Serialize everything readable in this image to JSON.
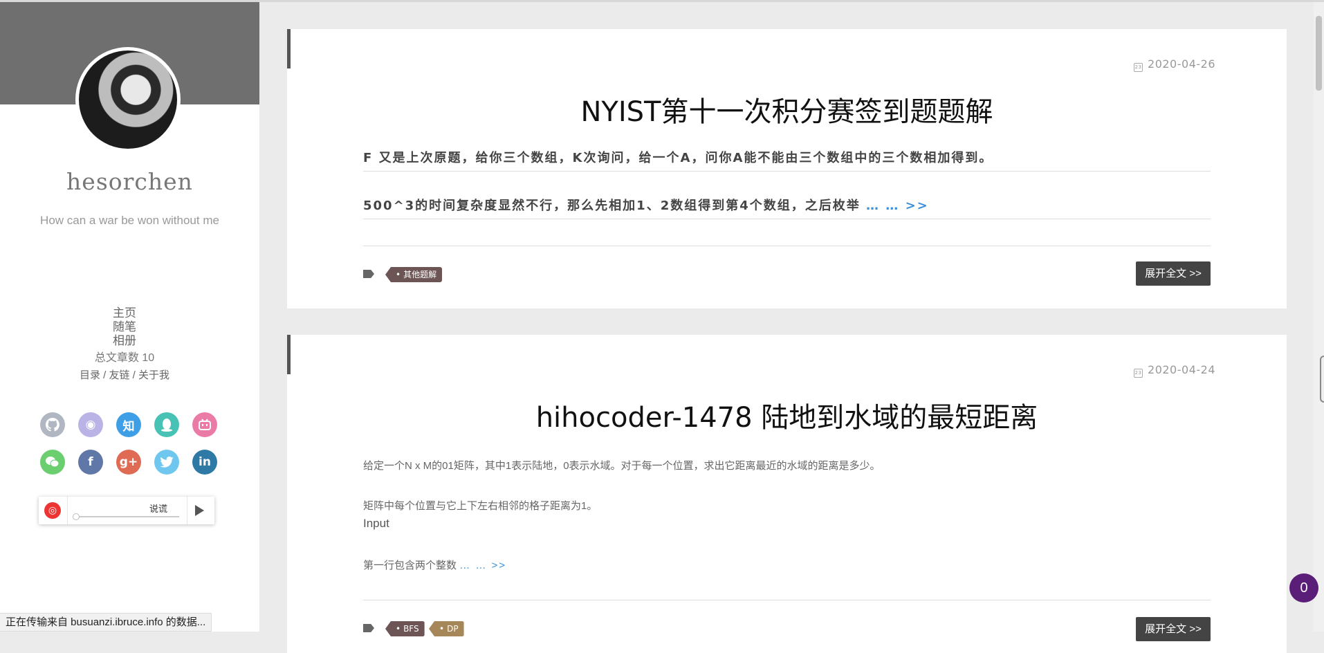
{
  "sidebar": {
    "author": "hesorchen",
    "motto": "How can a war be won without me",
    "nav": [
      "主页",
      "随笔",
      "相册"
    ],
    "post_count": "总文章数 10",
    "links": [
      "目录",
      "/ 友链",
      "/ 关于我"
    ],
    "social": [
      {
        "name": "github-icon",
        "glyph": "",
        "color": "#b0b7c3"
      },
      {
        "name": "weibo-icon",
        "glyph": "微",
        "color": "#b9b3e6"
      },
      {
        "name": "zhihu-icon",
        "glyph": "知",
        "color": "#3f9fe6"
      },
      {
        "name": "qq-icon",
        "glyph": "Q",
        "color": "#49c2b6"
      },
      {
        "name": "bilibili-icon",
        "glyph": "▣",
        "color": "#e97ba6"
      },
      {
        "name": "wechat-icon",
        "glyph": "◕",
        "color": "#6bcf6f"
      },
      {
        "name": "facebook-icon",
        "glyph": "f",
        "color": "#5f78a8"
      },
      {
        "name": "googleplus-icon",
        "glyph": "g+",
        "color": "#e06b55"
      },
      {
        "name": "twitter-icon",
        "glyph": "t",
        "color": "#6fc7ef"
      },
      {
        "name": "linkedin-icon",
        "glyph": "in",
        "color": "#2f79a6"
      }
    ],
    "player": {
      "song": "说谎"
    }
  },
  "status_bar": "正在传输来自 busuanzi.ibruce.info 的数据...",
  "posts": [
    {
      "date": "2020-04-26",
      "title": "NYIST第十一次积分赛签到题题解",
      "excerpt_lines": [
        "F 又是上次原题，给你三个数组，K次询问，给一个A，问你A能不能由三个数组中的三个数相加得到。",
        "500^3的时间复杂度显然不行，那么先相加1、2数组得到第4个数组，之后枚举"
      ],
      "more": "… … >>",
      "tags": [
        "其他题解"
      ],
      "readmore": "展开全文 >>"
    },
    {
      "date": "2020-04-24",
      "title": "hihocoder-1478 陆地到水域的最短距离",
      "excerpt_lines": [
        "给定一个N x M的01矩阵，其中1表示陆地，0表示水域。对于每一个位置，求出它距离最近的水域的距离是多少。",
        "矩阵中每个位置与它上下左右相邻的格子距离为1。",
        "Input",
        "第一行包含两个整数"
      ],
      "more": "… … >>",
      "tags": [
        "BFS",
        "DP"
      ],
      "readmore": "展开全文 >>"
    }
  ],
  "comment_count": "0"
}
